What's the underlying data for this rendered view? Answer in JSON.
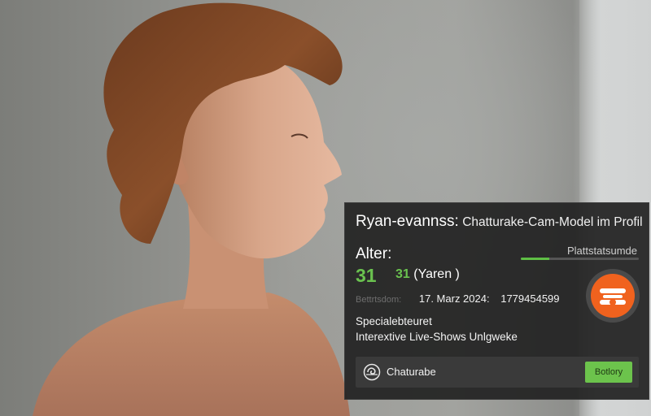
{
  "card": {
    "name": "Ryan-evannss:",
    "subtitle": "Chatturake-Cam-Model im Profil",
    "age_label": "Alter:",
    "age_value": "31",
    "age_years_num": "31",
    "age_years_text": "(Yaren )",
    "platform_label": "Plattstatsumde",
    "platform_progress_fraction": 0.24,
    "meta_label": "Bettrtsdom:",
    "meta_date": "17. Marz 2024:",
    "meta_id": "1779454599",
    "special_title": "Specialebteuret",
    "special_desc": "Interextive Live-Shows Unlgweke",
    "platform_name": "Chaturabe",
    "platform_button": "Botlory"
  },
  "colors": {
    "accent_green": "#6ac24f",
    "logo_orange": "#f0621e",
    "card_bg": "#222222"
  },
  "icons": {
    "logo": "masked-face-logo-icon",
    "platform": "spiral-logo-icon"
  }
}
